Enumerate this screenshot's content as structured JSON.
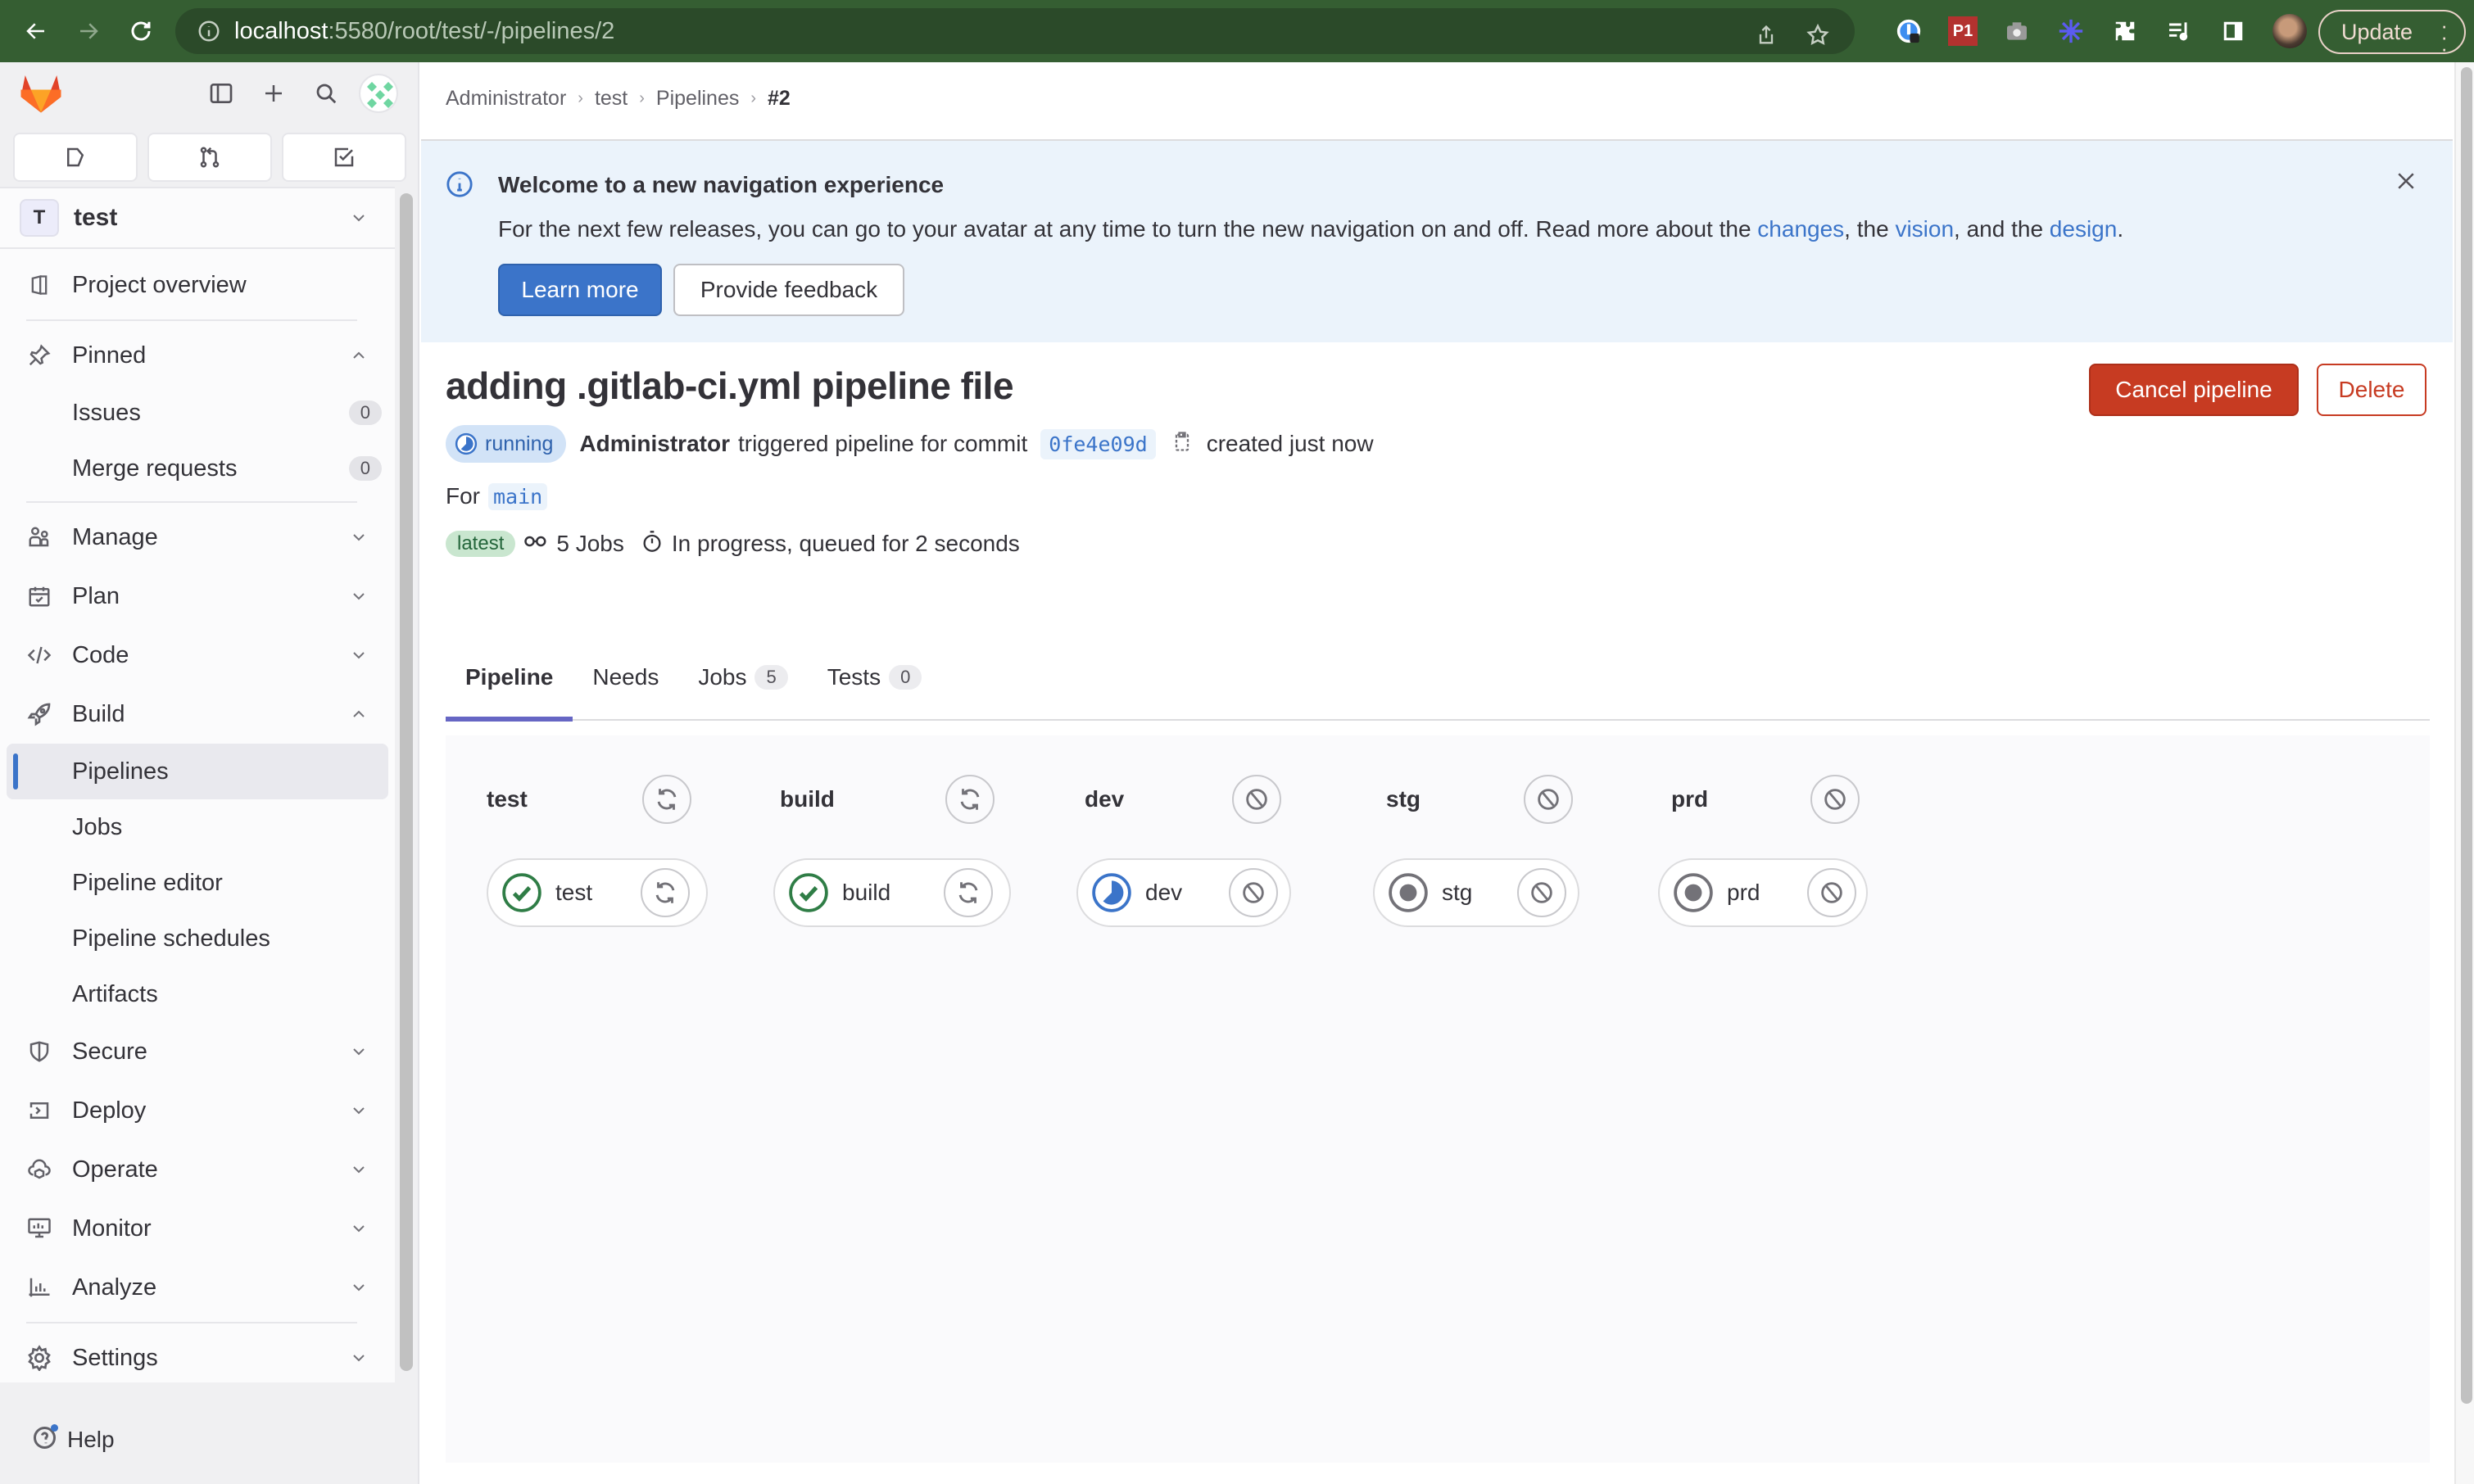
{
  "browser": {
    "url_host": "localhost",
    "url_path": ":5580/root/test/-/pipelines/2",
    "update_label": "Update",
    "extension_icons": [
      "1password-icon",
      "p1-extension-icon",
      "camera-icon",
      "sparkle-icon",
      "puzzle-icon",
      "media-queue-icon",
      "side-panel-icon"
    ],
    "p1_label": "P1"
  },
  "sidebar": {
    "project_initial": "T",
    "project_name": "test",
    "items": [
      {
        "label": "Project overview",
        "icon": "project-icon"
      },
      {
        "label": "Pinned",
        "icon": "pin-icon",
        "expanded": true
      },
      {
        "label": "Issues",
        "count": "0"
      },
      {
        "label": "Merge requests",
        "count": "0"
      },
      {
        "label": "Manage",
        "icon": "users-icon"
      },
      {
        "label": "Plan",
        "icon": "calendar-icon"
      },
      {
        "label": "Code",
        "icon": "code-icon"
      },
      {
        "label": "Build",
        "icon": "rocket-icon",
        "expanded": true
      },
      {
        "label": "Pipelines",
        "active": true
      },
      {
        "label": "Jobs"
      },
      {
        "label": "Pipeline editor"
      },
      {
        "label": "Pipeline schedules"
      },
      {
        "label": "Artifacts"
      },
      {
        "label": "Secure",
        "icon": "shield-icon"
      },
      {
        "label": "Deploy",
        "icon": "deploy-icon"
      },
      {
        "label": "Operate",
        "icon": "cloud-icon"
      },
      {
        "label": "Monitor",
        "icon": "monitor-icon"
      },
      {
        "label": "Analyze",
        "icon": "chart-icon"
      },
      {
        "label": "Settings",
        "icon": "gear-icon"
      }
    ],
    "help_label": "Help"
  },
  "breadcrumb": [
    "Administrator",
    "test",
    "Pipelines",
    "#2"
  ],
  "alert": {
    "title": "Welcome to a new navigation experience",
    "body_prefix": "For the next few releases, you can go to your avatar at any time to turn the new navigation on and off. Read more about the ",
    "link1": "changes",
    "mid1": ", the ",
    "link2": "vision",
    "mid2": ", and the ",
    "link3": "design",
    "suffix": ".",
    "learn_more": "Learn more",
    "feedback": "Provide feedback"
  },
  "pipeline": {
    "title": "adding .gitlab-ci.yml pipeline file",
    "cancel_label": "Cancel pipeline",
    "delete_label": "Delete",
    "status": "running",
    "triggered_by": "Administrator",
    "triggered_text": "triggered pipeline for commit",
    "sha": "0fe4e09d",
    "created_text": "created just now",
    "for_label": "For",
    "ref": "main",
    "latest_badge": "latest",
    "jobs_text": "5 Jobs",
    "duration_text": "In progress, queued for 2 seconds",
    "colors": {
      "running": "#3b74c9",
      "success": "#2f7d46",
      "created": "#737278",
      "danger": "#c73b22"
    }
  },
  "tabs": [
    {
      "label": "Pipeline",
      "active": true
    },
    {
      "label": "Needs"
    },
    {
      "label": "Jobs",
      "count": "5"
    },
    {
      "label": "Tests",
      "count": "0"
    }
  ],
  "stages": [
    {
      "name": "test",
      "action": "retry",
      "job": {
        "name": "test",
        "status": "success",
        "action": "retry"
      }
    },
    {
      "name": "build",
      "action": "retry",
      "job": {
        "name": "build",
        "status": "success",
        "action": "retry"
      }
    },
    {
      "name": "dev",
      "action": "cancel",
      "job": {
        "name": "dev",
        "status": "running",
        "action": "cancel"
      }
    },
    {
      "name": "stg",
      "action": "cancel",
      "job": {
        "name": "stg",
        "status": "created",
        "action": "cancel"
      }
    },
    {
      "name": "prd",
      "action": "cancel",
      "job": {
        "name": "prd",
        "status": "created",
        "action": "cancel"
      }
    }
  ]
}
